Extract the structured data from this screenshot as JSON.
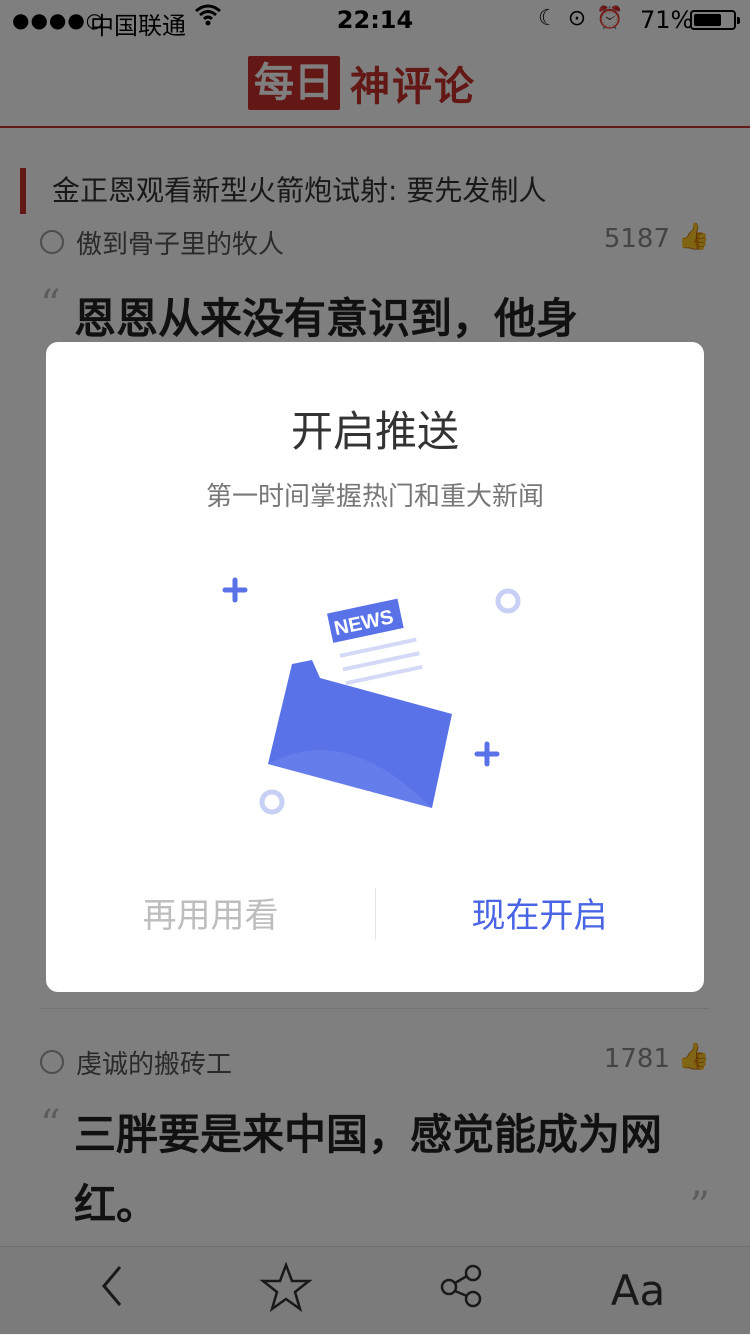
{
  "status_bar": {
    "signal_dots": "●●●●○",
    "carrier": "中国联通",
    "time": "22:14",
    "battery_percent": "71%",
    "battery_level": 0.71
  },
  "header": {
    "logo_box": "每日",
    "logo_rest": "神评论"
  },
  "article": {
    "title": "金正恩观看新型火箭炮试射: 要先发制人"
  },
  "comments": [
    {
      "user": "傲到骨子里的牧人",
      "likes": "5187",
      "text": "恩恩从来没有意识到，他身"
    },
    {
      "user": "虔诚的搬砖工",
      "likes": "1781",
      "text": "三胖要是来中国，感觉能成为网红。"
    }
  ],
  "modal": {
    "title": "开启推送",
    "subtitle": "第一时间掌握热门和重大新闻",
    "illustration_badge": "NEWS",
    "later_label": "再用用看",
    "enable_label": "现在开启",
    "accent_color": "#4a64e6"
  },
  "toolbar": {
    "font_label": "Aa",
    "icons": [
      "back-icon",
      "star-icon",
      "share-icon",
      "font-size-icon"
    ]
  }
}
